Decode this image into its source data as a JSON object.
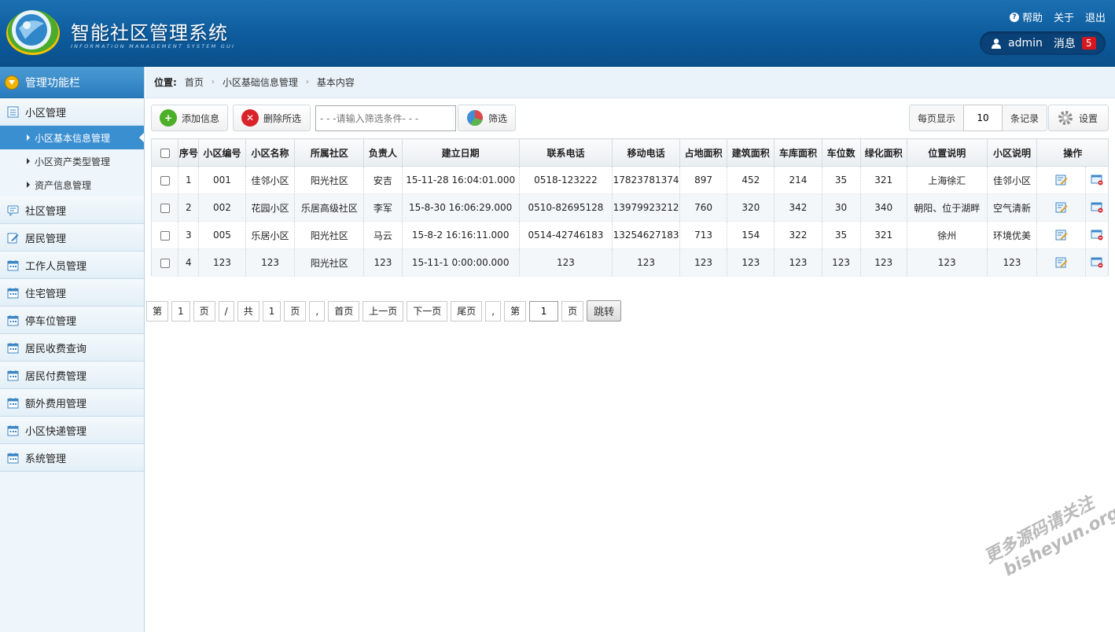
{
  "header": {
    "title": "智能社区管理系统",
    "subtitle": "INFORMATION MANAGEMENT SYSTEM GUI",
    "links": {
      "help": "帮助",
      "about": "关于",
      "logout": "退出"
    },
    "user": "admin",
    "messages_label": "消息",
    "messages_count": "5"
  },
  "sidebar": {
    "heading": "管理功能栏",
    "groups": [
      {
        "label": "小区管理",
        "children": [
          "小区基本信息管理",
          "小区资产类型管理",
          "资产信息管理"
        ],
        "active_child": 0
      },
      {
        "label": "社区管理"
      },
      {
        "label": "居民管理"
      },
      {
        "label": "工作人员管理"
      },
      {
        "label": "住宅管理"
      },
      {
        "label": "停车位管理"
      },
      {
        "label": "居民收费查询"
      },
      {
        "label": "居民付费管理"
      },
      {
        "label": "额外费用管理"
      },
      {
        "label": "小区快递管理"
      },
      {
        "label": "系统管理"
      }
    ]
  },
  "breadcrumb": {
    "lead": "位置:",
    "items": [
      "首页",
      "小区基础信息管理",
      "基本内容"
    ]
  },
  "toolbar": {
    "add": "添加信息",
    "delete": "删除所选",
    "filter_placeholder": "- - -请输入筛选条件- - -",
    "filter_btn": "筛选",
    "per_page_label": "每页显示",
    "per_page_value": "10",
    "records_label": "条记录",
    "settings": "设置"
  },
  "table": {
    "headers": [
      "序号",
      "小区编号",
      "小区名称",
      "所属社区",
      "负责人",
      "建立日期",
      "联系电话",
      "移动电话",
      "占地面积",
      "建筑面积",
      "车库面积",
      "车位数",
      "绿化面积",
      "位置说明",
      "小区说明",
      "操作"
    ],
    "rows": [
      [
        "1",
        "001",
        "佳邻小区",
        "阳光社区",
        "安吉",
        "15-11-28 16:04:01.000",
        "0518-123222",
        "17823781374",
        "897",
        "452",
        "214",
        "35",
        "321",
        "上海徐汇",
        "佳邻小区"
      ],
      [
        "2",
        "002",
        "花园小区",
        "乐居高级社区",
        "李军",
        "15-8-30 16:06:29.000",
        "0510-82695128",
        "13979923212",
        "760",
        "320",
        "342",
        "30",
        "340",
        "朝阳、位于湖畔",
        "空气清新"
      ],
      [
        "3",
        "005",
        "乐居小区",
        "阳光社区",
        "马云",
        "15-8-2 16:16:11.000",
        "0514-42746183",
        "13254627183",
        "713",
        "154",
        "322",
        "35",
        "321",
        "徐州",
        "环境优美"
      ],
      [
        "4",
        "123",
        "123",
        "阳光社区",
        "123",
        "15-11-1 0:00:00.000",
        "123",
        "123",
        "123",
        "123",
        "123",
        "123",
        "123",
        "123",
        "123"
      ]
    ]
  },
  "pager": {
    "di": "第",
    "page": "1",
    "ye": "页",
    "slash": "/",
    "gong": "共",
    "total": "1",
    "ye2": "页",
    "comma": ",",
    "first": "首页",
    "prev": "上一页",
    "next": "下一页",
    "last": "尾页",
    "comma2": ",",
    "di2": "第",
    "jump_value": "1",
    "ye3": "页",
    "jump": "跳转"
  },
  "watermark": {
    "line1": "更多源码请关注",
    "line2": "bisheyun.org"
  },
  "colors": {
    "header": "#0d5b9c",
    "sidebar_active": "#3a8fd1",
    "badge": "#d7161e"
  }
}
